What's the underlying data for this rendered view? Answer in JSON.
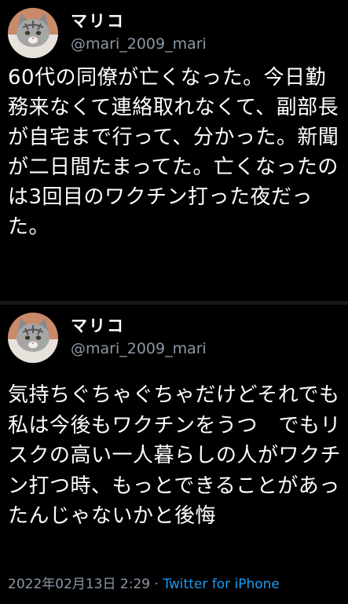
{
  "colors": {
    "background": "#000000",
    "text": "#ffffff",
    "secondary_text": "#8b98a5",
    "link": "#1d9bf0",
    "divider": "#16181c"
  },
  "tweets": [
    {
      "display_name": "マリコ",
      "handle": "@mari_2009_mari",
      "avatar_icon": "cat-avatar-icon",
      "text": "60代の同僚が亡くなった。今日勤務来なくて連絡取れなくて、副部長が自宅まで行って、分かった。新聞が二日間たまってた。亡くなったのは3回目のワクチン打った夜だった。"
    },
    {
      "display_name": "マリコ",
      "handle": "@mari_2009_mari",
      "avatar_icon": "cat-avatar-icon",
      "text": "気持ちぐちゃぐちゃだけどそれでも私は今後もワクチンをうつ　でもリスクの高い一人暮らしの人がワクチン打つ時、もっとできることがあったんじゃないかと後悔",
      "timestamp": "2022年02月13日 2:29",
      "separator": "·",
      "source": "Twitter for iPhone"
    }
  ]
}
